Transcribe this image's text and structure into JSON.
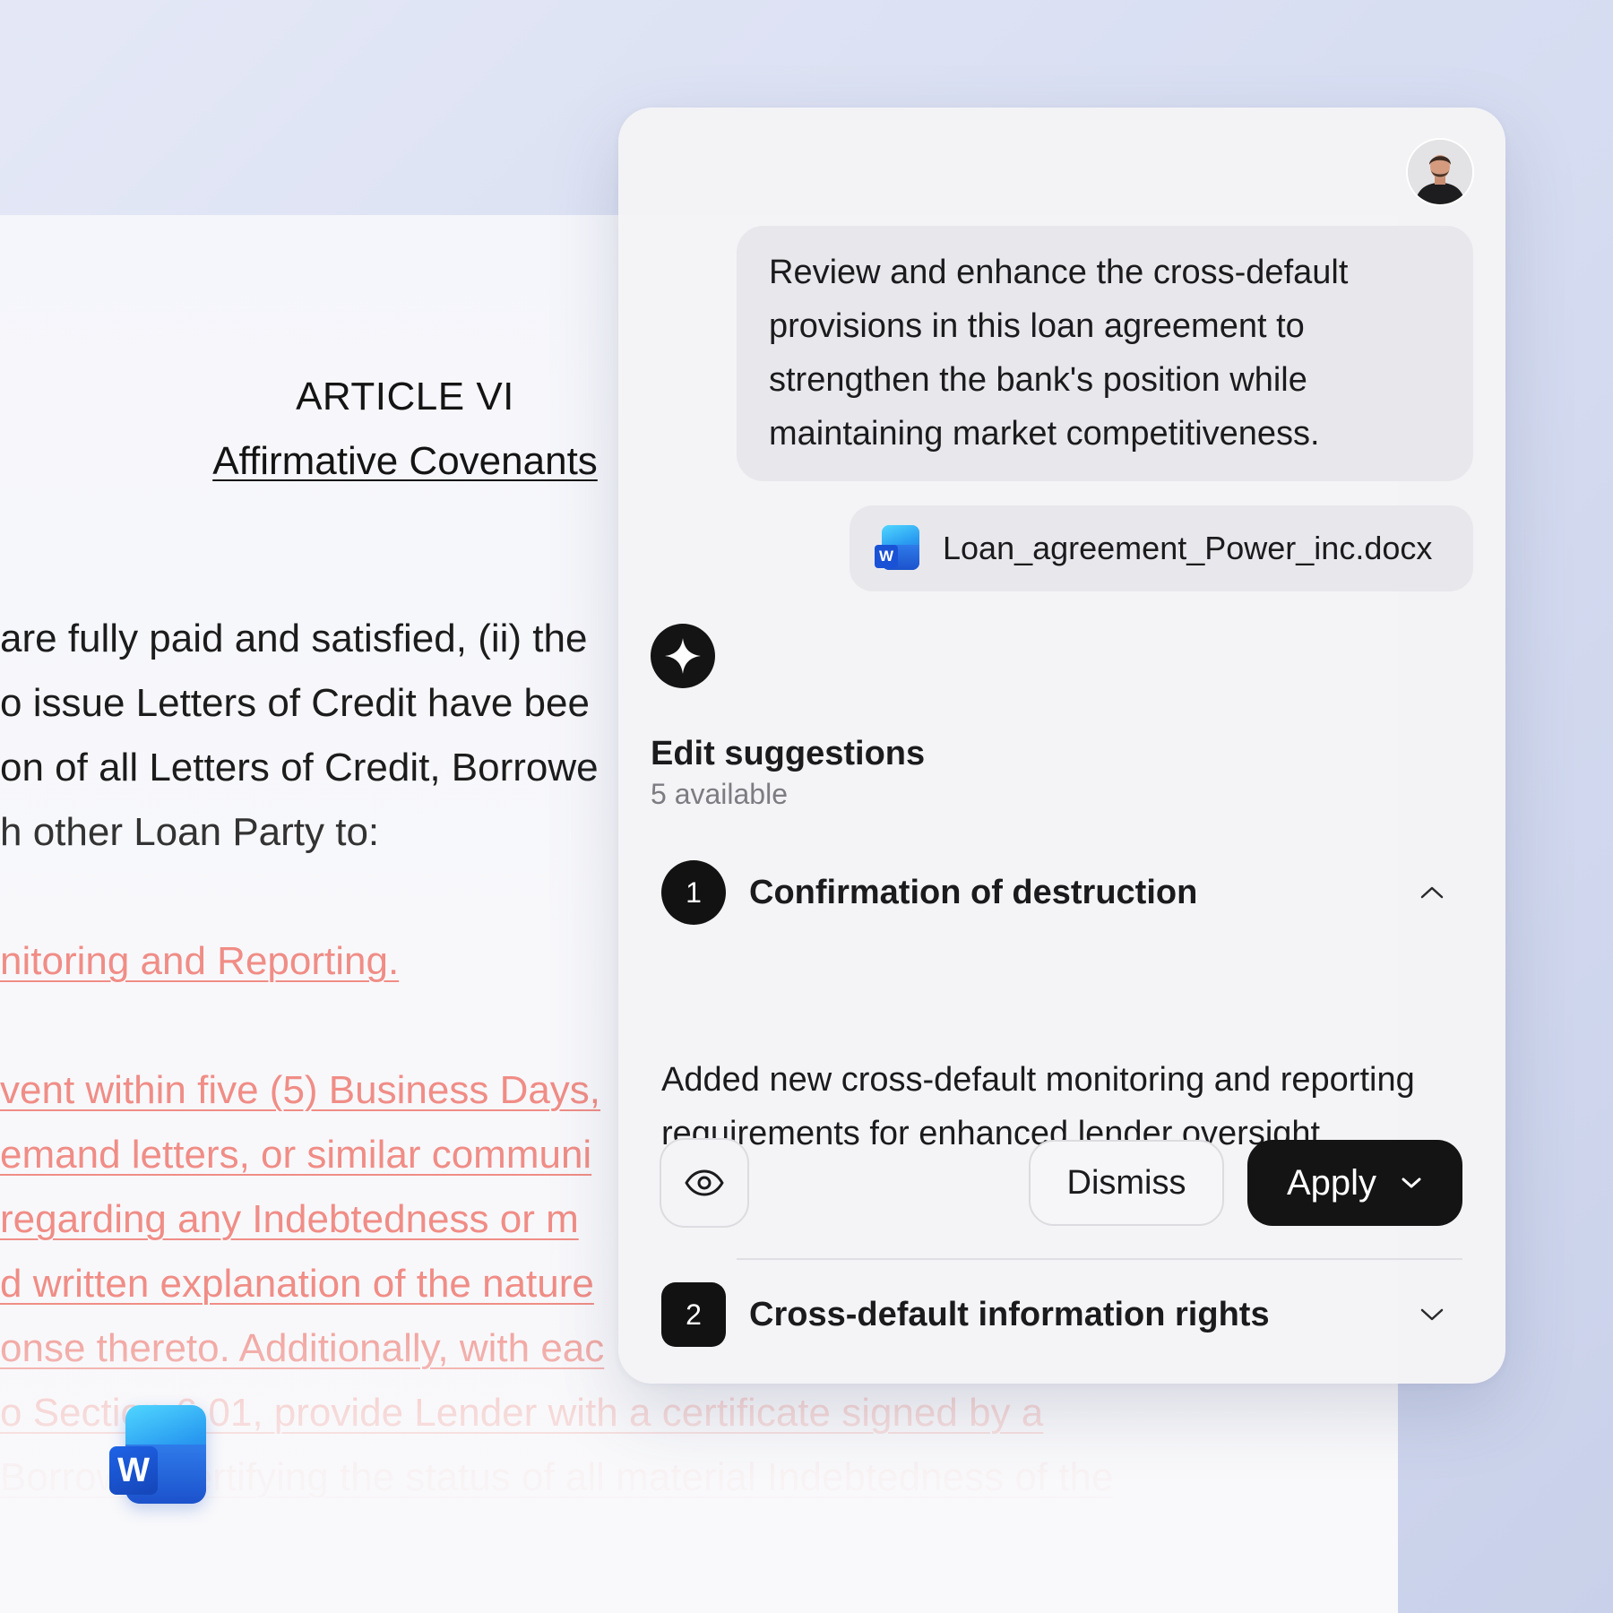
{
  "document": {
    "article": "ARTICLE VI",
    "subtitle": "Affirmative Covenants",
    "lines": [
      "are fully paid and satisfied, (ii) the",
      "o issue Letters of Credit have bee",
      "on of all Letters of Credit, Borrowe",
      "h other Loan Party to:"
    ],
    "red_lines": [
      "nitoring and Reporting. ",
      "vent within five (5) Business Days, ",
      "emand letters, or similar communi",
      " regarding any Indebtedness or m",
      "d written explanation of the nature",
      "onse thereto. Additionally, with eac",
      "o Section 6.01, provide Lender with a certificate signed by a",
      "Borrower certifying the status of all material Indebtedness of the"
    ],
    "word_icon_letter": "W"
  },
  "chat": {
    "avatar_icon": "user-avatar",
    "message": "Review and enhance the cross-default provisions in this loan agreement to strengthen the bank's position while maintaining market competitiveness.",
    "attachment": {
      "icon": "word-doc-icon",
      "letter": "W",
      "filename": "Loan_agreement_Power_inc.docx"
    },
    "assistant_icon": "sparkle-icon",
    "suggestions_title": "Edit suggestions",
    "suggestions_count": "5 available",
    "suggestions": [
      {
        "number": "1",
        "title": "Confirmation of destruction",
        "expanded": true,
        "description": "Added new cross-default monitoring and reporting requirements for enhanced lender oversight.",
        "preview_icon": "eye-icon",
        "dismiss_label": "Dismiss",
        "apply_label": "Apply"
      },
      {
        "number": "2",
        "title": "Cross-default information rights",
        "expanded": false
      }
    ]
  },
  "colors": {
    "redline": "#f08d86",
    "accent_dark": "#141414",
    "panel_bg": "#f4f4f6"
  }
}
